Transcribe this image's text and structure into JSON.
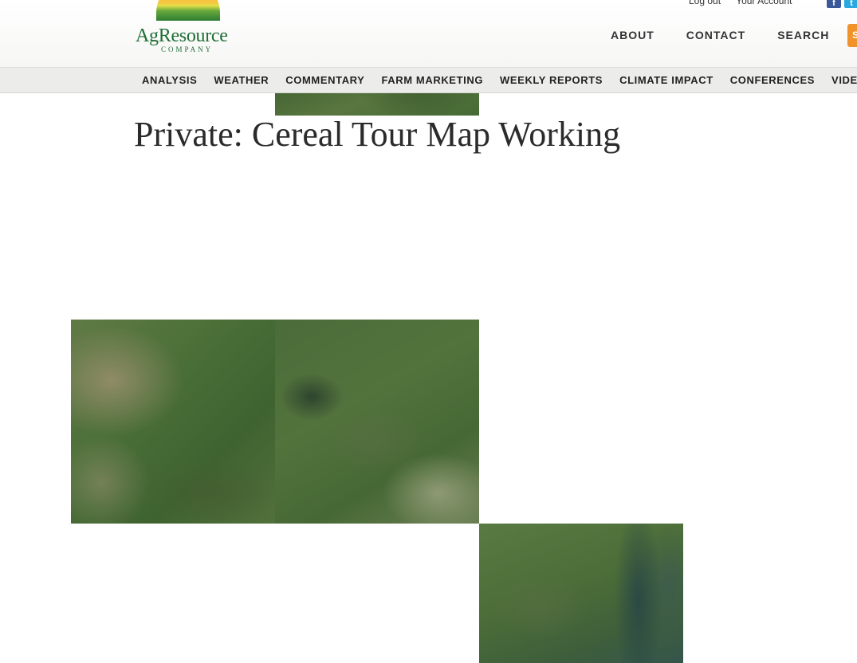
{
  "brand": {
    "name": "AgResource",
    "tagline": "COMPANY"
  },
  "utility_links": [
    "Log out",
    "Your Account"
  ],
  "social": [
    {
      "icon": "facebook-icon",
      "glyph": "f"
    },
    {
      "icon": "twitter-icon",
      "glyph": "t"
    }
  ],
  "main_nav": [
    "ABOUT",
    "CONTACT",
    "SEARCH"
  ],
  "subscribe_label": "S",
  "sub_nav": [
    "ANALYSIS",
    "WEATHER",
    "COMMENTARY",
    "FARM MARKETING",
    "WEEKLY REPORTS",
    "CLIMATE IMPACT",
    "CONFERENCES",
    "VIDEO"
  ],
  "page_title": "Private: Cereal Tour Map Working",
  "map": {
    "tiles": [
      "satellite-tile",
      "satellite-tile",
      "satellite-tile",
      "satellite-tile"
    ]
  },
  "colors": {
    "brand_green": "#1e6e34",
    "accent_orange": "#f0932b",
    "subnav_bg": "#ececea"
  }
}
